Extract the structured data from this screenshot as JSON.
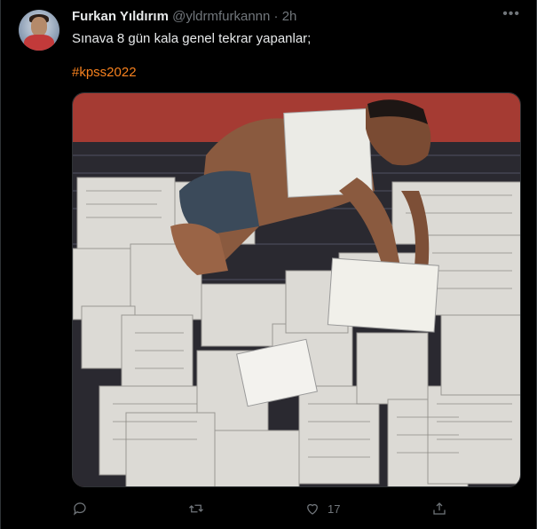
{
  "tweet": {
    "display_name": "Furkan Yıldırım",
    "handle": "@yldrmfurkannn",
    "separator": "·",
    "time": "2h",
    "more_label": "•••",
    "text": "Sınava 8 gün kala genel tekrar yapanlar;",
    "hashtag": "#kpss2022"
  },
  "actions": {
    "reply_count": "",
    "retweet_count": "",
    "like_count": "17",
    "share_label": ""
  },
  "colors": {
    "background": "#000000",
    "hashtag": "#f7811e",
    "muted": "#71767b",
    "text": "#e7e9ea"
  },
  "icons": [
    "reply-icon",
    "retweet-icon",
    "like-icon",
    "share-icon",
    "more-icon"
  ]
}
